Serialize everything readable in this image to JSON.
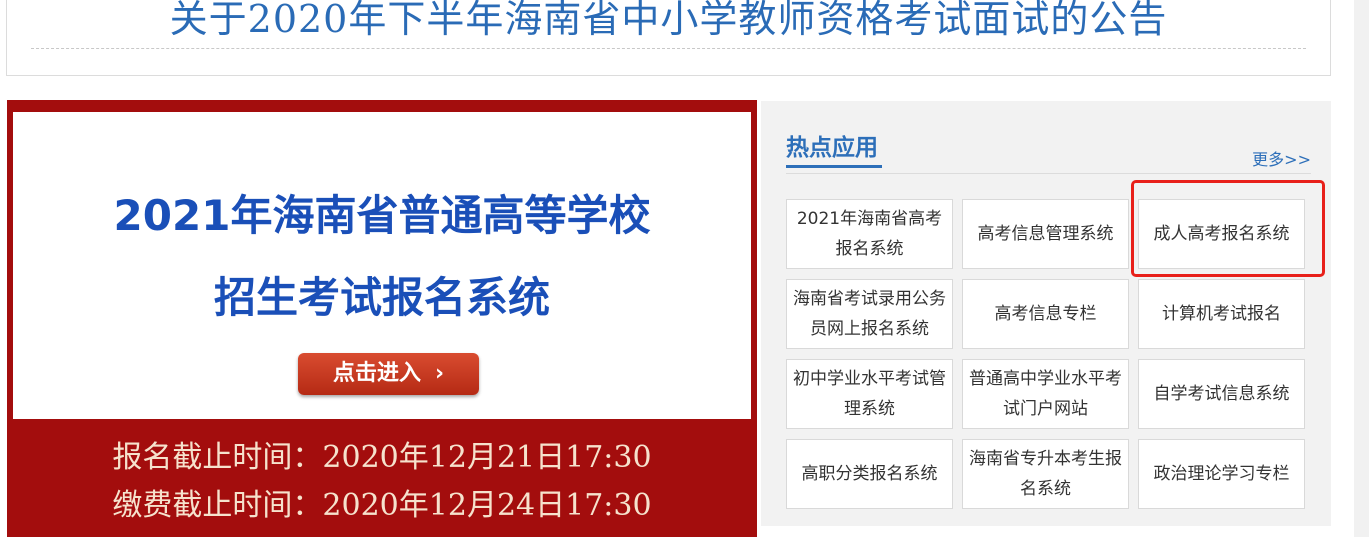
{
  "notice": {
    "title": "关于2020年下半年海南省中小学教师资格考试面试的公告"
  },
  "banner": {
    "title_line1": "2021年海南省普通高等学校",
    "title_line2": "招生考试报名系统",
    "enter_label": "点击进入",
    "enter_arrow": "›",
    "deadline_registration": "报名截止时间：2020年12月21日17:30",
    "deadline_payment": "缴费截止时间：2020年12月24日17:30",
    "colors": {
      "background": "#a30d0d",
      "title": "#1a4fb8",
      "button": "#c63a20"
    }
  },
  "hot_apps": {
    "title": "热点应用",
    "more_label": "更多>>",
    "items": [
      {
        "label": "2021年海南省高考报名系统"
      },
      {
        "label": "高考信息管理系统"
      },
      {
        "label": "成人高考报名系统"
      },
      {
        "label": "海南省考试录用公务员网上报名系统"
      },
      {
        "label": "高考信息专栏"
      },
      {
        "label": "计算机考试报名"
      },
      {
        "label": "初中学业水平考试管理系统"
      },
      {
        "label": "普通高中学业水平考试门户网站"
      },
      {
        "label": "自学考试信息系统"
      },
      {
        "label": "高职分类报名系统"
      },
      {
        "label": "海南省专升本考生报名系统"
      },
      {
        "label": "政治理论学习专栏"
      }
    ],
    "highlighted_item": "成人高考报名系统",
    "colors": {
      "accent": "#2d6fb9",
      "highlight_border": "#e8201a"
    }
  }
}
